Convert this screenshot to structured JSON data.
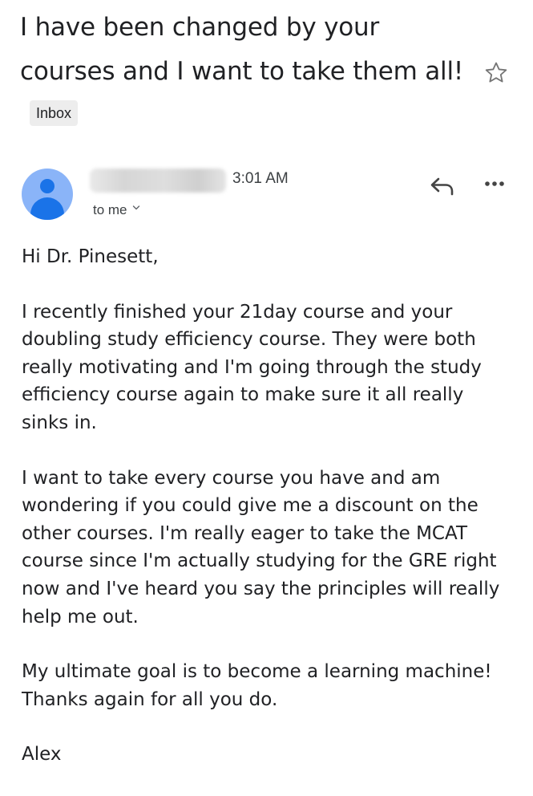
{
  "email": {
    "subject": "I have been changed by your courses and I want to take them all!",
    "label": "Inbox",
    "sender": {
      "time": "3:01 AM",
      "recipient": "to me"
    },
    "body": {
      "greeting": "Hi Dr. Pinesett,",
      "paragraph_1": "I recently finished your 21day course and your doubling study efficiency course. They were both really motivating and I'm going through the study efficiency course again to make sure it all really sinks in.",
      "paragraph_2": "I want to take every course you have and am wondering if you could give me a discount on the other courses. I'm really eager to take the MCAT course since I'm actually studying for the GRE right now and I've heard you say the principles will really help me out.",
      "paragraph_3": "My ultimate goal is to become a learning machine! Thanks again for all you do.",
      "signature": "Alex"
    }
  },
  "icons": {
    "star": "star-icon",
    "avatar": "person-icon",
    "reply": "reply-icon",
    "more": "more-horizontal-icon",
    "recipient_toggle": "chevron-down-icon"
  },
  "colors": {
    "avatar_background": "#8ab4f8",
    "avatar_foreground": "#1a73e8",
    "label_background": "#ededed",
    "text": "#202124"
  }
}
